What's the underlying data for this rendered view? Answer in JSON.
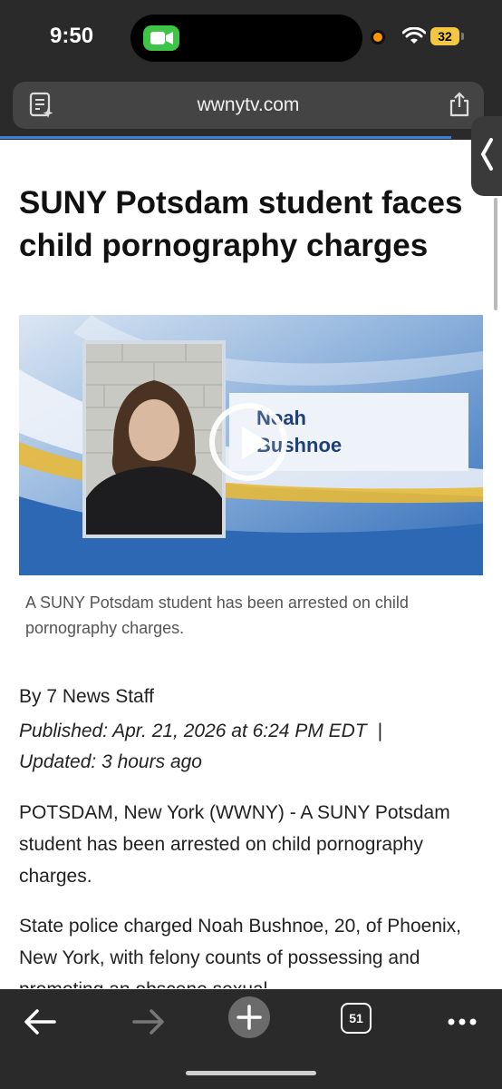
{
  "status_bar": {
    "time": "9:50",
    "battery": "32"
  },
  "browser": {
    "url": "wwnytv.com",
    "open_tabs": "51"
  },
  "article": {
    "headline": "SUNY Potsdam student faces child pornography charges",
    "video": {
      "name_line1": "Noah",
      "name_line2": "Bushnoe"
    },
    "caption": "A SUNY Potsdam student has been arrested on child pornography charges.",
    "byline": "By 7 News Staff",
    "published": "Published: Apr. 21, 2026 at 6:24 PM EDT",
    "updated": "Updated: 3 hours ago",
    "paragraphs": [
      "POTSDAM, New York (WWNY) - A SUNY Potsdam student has been arrested on child pornography charges.",
      "State police charged Noah Bushnoe, 20, of Phoenix, New York, with felony counts of possessing and promoting an obscene sexual"
    ]
  },
  "icons": [
    "video-camera-icon",
    "wifi-icon",
    "reader-icon",
    "share-icon",
    "back-arrow-icon",
    "forward-arrow-icon",
    "plus-icon",
    "tabs-icon",
    "more-icon",
    "play-icon",
    "chevron-left-icon"
  ]
}
